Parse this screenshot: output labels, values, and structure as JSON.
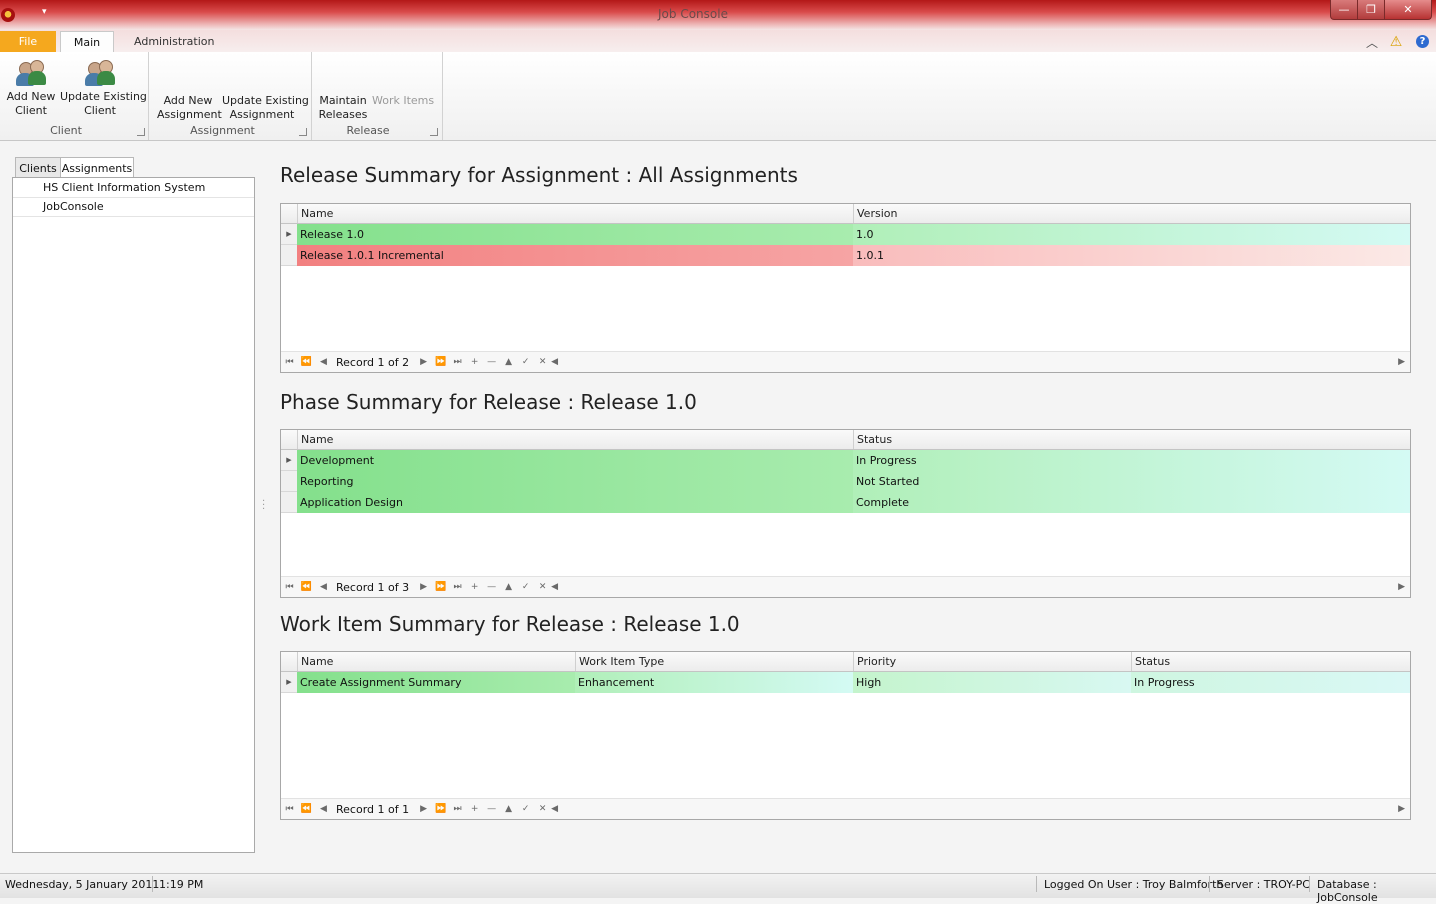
{
  "window": {
    "title": "Job Console",
    "qat_glyph": "▾",
    "min": "—",
    "max": "❐",
    "close": "✕"
  },
  "ribbon_tabs": {
    "file": "File",
    "main": "Main",
    "administration": "Administration"
  },
  "ribbon": {
    "client_group": {
      "label": "Client",
      "add_new": "Add New\nClient",
      "update_existing": "Update Existing\nClient"
    },
    "assignment_group": {
      "label": "Assignment",
      "add_new": "Add New\nAssignment",
      "update_existing": "Update Existing\nAssignment"
    },
    "release_group": {
      "label": "Release",
      "maintain": "Maintain\nReleases",
      "work_items": "Work Items"
    }
  },
  "icons": {
    "collapse": "︿",
    "warning": "⚠",
    "help": "?"
  },
  "sidebar": {
    "tabs": [
      "Clients",
      "Assignments"
    ],
    "items": [
      "HS Client Information System",
      "JobConsole"
    ]
  },
  "release_summary": {
    "title": "Release Summary for Assignment : All Assignments",
    "columns": [
      "Name",
      "Version"
    ],
    "rows": [
      {
        "name": "Release 1.0",
        "version": "1.0",
        "status_color": "#84e08c"
      },
      {
        "name": "Release 1.0.1 Incremental",
        "version": "1.0.1",
        "status_color": "#f28080"
      }
    ],
    "navigator": "Record 1 of 2"
  },
  "phase_summary": {
    "title": "Phase Summary for Release : Release 1.0",
    "columns": [
      "Name",
      "Status"
    ],
    "rows": [
      {
        "name": "Development",
        "status": "In Progress"
      },
      {
        "name": "Reporting",
        "status": "Not Started"
      },
      {
        "name": "Application Design",
        "status": "Complete"
      }
    ],
    "navigator": "Record 1 of 3"
  },
  "work_item_summary": {
    "title": "Work Item Summary for Release : Release 1.0",
    "columns": [
      "Name",
      "Work Item Type",
      "Priority",
      "Status"
    ],
    "rows": [
      {
        "name": "Create Assignment Summary",
        "type": "Enhancement",
        "priority": "High",
        "status": "In Progress"
      }
    ],
    "navigator": "Record 1 of 1"
  },
  "status_bar": {
    "date": "Wednesday, 5 January 2011",
    "time": "1:19 PM",
    "user": "Logged On User : Troy Balmforth",
    "server": "Server : TROY-PC",
    "database": "Database : JobConsole"
  }
}
